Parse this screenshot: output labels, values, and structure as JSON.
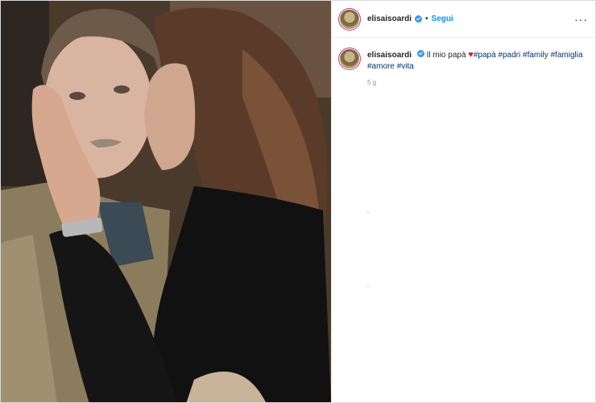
{
  "post": {
    "username": "elisaisoardi",
    "follow_label": "Segui",
    "more_icon": "more-horizontal-icon",
    "caption_text": "Il mio papà",
    "heart_glyph": "♥",
    "hashtags": [
      "#papà",
      "#padri",
      "#family",
      "#famiglia",
      "#amore",
      "#vita"
    ],
    "time_ago": "5 g"
  },
  "colors": {
    "link": "#0095f6",
    "hashtag": "#00376b",
    "heart": "#d11a2a",
    "verified": "#3897f0"
  }
}
